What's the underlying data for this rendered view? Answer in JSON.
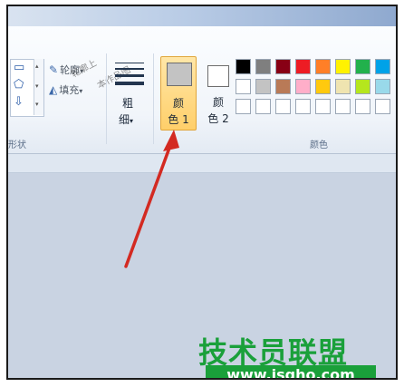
{
  "ribbon": {
    "shapes_group_label": "形状",
    "outline_label": "轮廓",
    "fill_label": "填充",
    "size_label_top": "粗",
    "size_label_bottom": "细",
    "size_arrow": "▾",
    "color1_line1": "颜",
    "color1_line2": "色 1",
    "color2_line1": "颜",
    "color2_line2": "色 2",
    "colors_group_label": "颜色"
  },
  "icons": {
    "outline": "pencil-icon",
    "fill": "bucket-icon",
    "dropdown": "chevron-down-icon"
  },
  "colors": {
    "color1": "#c3c3c3",
    "color2": "#ffffff",
    "palette_row1": [
      "#000000",
      "#7f7f7f",
      "#880015",
      "#ed1c24",
      "#ff7f27",
      "#fff200",
      "#22b14c",
      "#00a2e8"
    ],
    "palette_row2": [
      "#ffffff",
      "#c3c3c3",
      "#b97a57",
      "#ffaec9",
      "#ffc90e",
      "#efe4b0",
      "#b5e61d",
      "#99d9ea"
    ],
    "palette_row3": [
      "#ffffff",
      "#ffffff",
      "#ffffff",
      "#ffffff",
      "#ffffff",
      "#ffffff",
      "#ffffff",
      "#ffffff"
    ],
    "accent_selected": "#ffcf6a",
    "annotation_arrow": "#d32a22"
  },
  "watermark": {
    "overlay_1": "轮廓上",
    "overlay_2": "本作品图",
    "main": "技术员联盟",
    "url": "www.jsgho.com"
  }
}
